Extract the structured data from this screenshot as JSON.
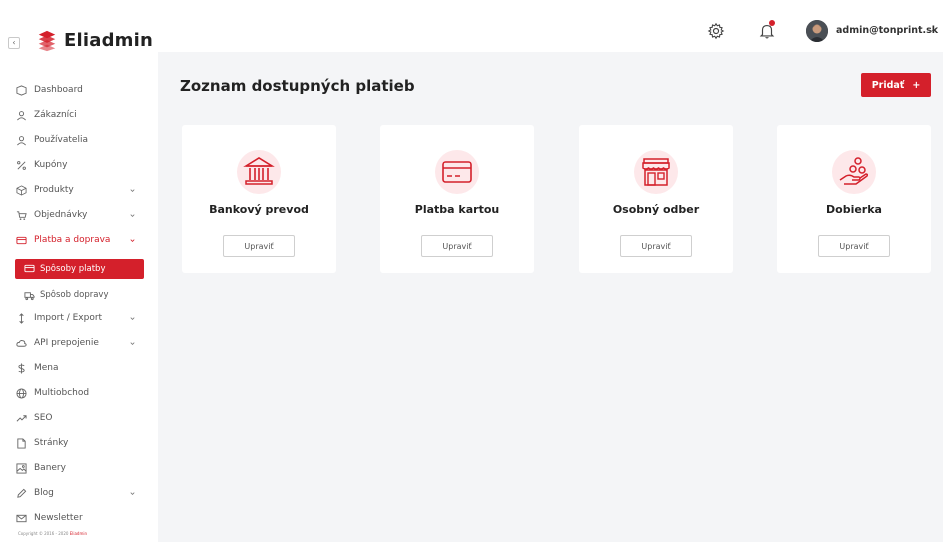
{
  "brand": {
    "name": "Eliadmin",
    "collapse_icon": "chevron-left-icon"
  },
  "colors": {
    "accent": "#d4202b",
    "background": "#f4f5f7",
    "card": "#ffffff",
    "icon_blob": "#fde8ea"
  },
  "sidebar": {
    "items": [
      {
        "label": "Dashboard",
        "icon": "dashboard-icon"
      },
      {
        "label": "Zákazníci",
        "icon": "user-icon"
      },
      {
        "label": "Používatelia",
        "icon": "user-icon"
      },
      {
        "label": "Kupóny",
        "icon": "percent-icon"
      },
      {
        "label": "Produkty",
        "icon": "box-icon",
        "has_submenu": true
      },
      {
        "label": "Objednávky",
        "icon": "cart-icon",
        "has_submenu": true
      },
      {
        "label": "Platba a doprava",
        "icon": "card-icon",
        "has_submenu": true,
        "expanded": true
      },
      {
        "label": "Spôsoby platby",
        "icon": "card-icon",
        "active": true
      },
      {
        "label": "Spôsob dopravy",
        "icon": "truck-icon"
      },
      {
        "label": "Import / Export",
        "icon": "import-export-icon",
        "has_submenu": true
      },
      {
        "label": "API prepojenie",
        "icon": "cloud-icon",
        "has_submenu": true
      },
      {
        "label": "Mena",
        "icon": "dollar-icon"
      },
      {
        "label": "Multiobchod",
        "icon": "globe-icon"
      },
      {
        "label": "SEO",
        "icon": "trend-icon"
      },
      {
        "label": "Stránky",
        "icon": "page-icon"
      },
      {
        "label": "Banery",
        "icon": "image-icon"
      },
      {
        "label": "Blog",
        "icon": "pen-icon",
        "has_submenu": true
      },
      {
        "label": "Newsletter",
        "icon": "mail-icon"
      }
    ],
    "copyright_prefix": "Copyright © 2016 - 2020 ",
    "copyright_link": "Eliadmin"
  },
  "header": {
    "settings_icon": "gear-icon",
    "notifications_icon": "bell-icon",
    "user_email": "admin@tonprint.sk",
    "user_menu_icon": "chevron-down-icon"
  },
  "main": {
    "title": "Zoznam dostupných platieb",
    "add_button": "Pridať",
    "add_button_icon": "+",
    "cards": [
      {
        "title": "Bankový prevod",
        "icon": "bank-icon",
        "button": "Upraviť"
      },
      {
        "title": "Platba kartou",
        "icon": "credit-card-icon",
        "button": "Upraviť"
      },
      {
        "title": "Osobný odber",
        "icon": "store-icon",
        "button": "Upraviť"
      },
      {
        "title": "Dobierka",
        "icon": "coins-hand-icon",
        "button": "Upraviť"
      }
    ]
  }
}
